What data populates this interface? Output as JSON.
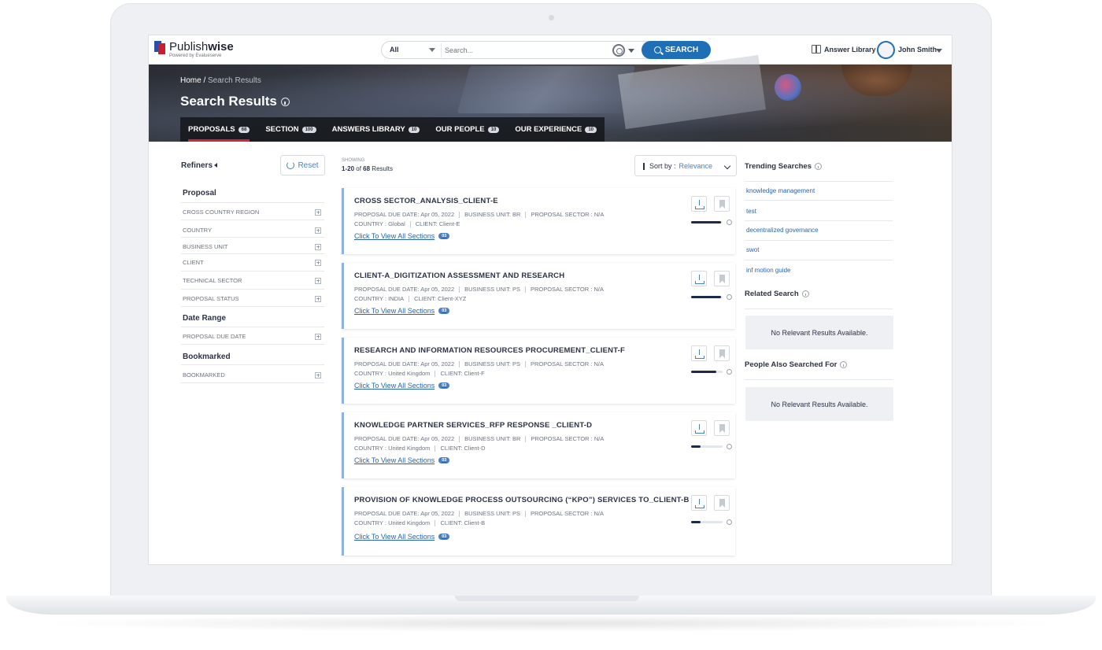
{
  "header": {
    "logo_main": "Publish",
    "logo_bold": "wise",
    "logo_sub": "Powered by Evalueserve",
    "search_scope": "All",
    "search_placeholder": "Search...",
    "search_button": "SEARCH",
    "answer_library": "Answer Library",
    "user_name": "John Smith"
  },
  "banner": {
    "breadcrumb_home": "Home /",
    "breadcrumb_current": "Search Results",
    "title": "Search Results",
    "tabs": [
      {
        "label": "PROPOSALS",
        "count": "68"
      },
      {
        "label": "SECTION",
        "count": "100"
      },
      {
        "label": "ANSWERS LIBRARY",
        "count": "10"
      },
      {
        "label": "OUR PEOPLE",
        "count": "10"
      },
      {
        "label": "OUR EXPERIENCE",
        "count": "10"
      }
    ]
  },
  "refiners": {
    "title": "Refiners",
    "reset": "Reset",
    "sections": [
      {
        "title": "Proposal",
        "items": [
          "CROSS COUNTRY REGION",
          "COUNTRY",
          "BUSINESS UNIT",
          "CLIENT",
          "TECHNICAL SECTOR",
          "PROPOSAL STATUS"
        ]
      },
      {
        "title": "Date Range",
        "items": [
          "PROPOSAL DUE DATE"
        ]
      },
      {
        "title": "Bookmarked",
        "items": [
          "BOOKMARKED"
        ]
      }
    ]
  },
  "results": {
    "showing_label": "SHOWING",
    "range_prefix": "1-20",
    "range_of": "of",
    "range_total": "68",
    "range_suffix": "Results",
    "sort_label": "Sort by :",
    "sort_value": "Relevance",
    "view_link": "Click To View All Sections",
    "items": [
      {
        "title": "CROSS SECTOR_ANALYSIS_CLIENT-E",
        "due": "PROPOSAL DUE DATE: Apr 05, 2022",
        "bu": "BUSINESS UNIT: BR",
        "sector": "PROPOSAL SECTOR : N/A",
        "country": "COUNTRY : Global",
        "client": "CLIENT: Client-E",
        "sections": "03",
        "progress": 0.95
      },
      {
        "title": "CLIENT-A_DIGITIZATION ASSESSMENT AND RESEARCH",
        "due": "PROPOSAL DUE DATE: Apr 05, 2022",
        "bu": "BUSINESS UNIT: PS",
        "sector": "PROPOSAL SECTOR : N/A",
        "country": "COUNTRY : INDIA",
        "client": "CLIENT: Client-XYZ",
        "sections": "03",
        "progress": 0.95
      },
      {
        "title": "RESEARCH AND INFORMATION RESOURCES PROCUREMENT_CLIENT-F",
        "due": "PROPOSAL DUE DATE: Apr 05, 2022",
        "bu": "BUSINESS UNIT: PS",
        "sector": "PROPOSAL SECTOR : N/A",
        "country": "COUNTRY : United Kingdom",
        "client": "CLIENT: Client-F",
        "sections": "03",
        "progress": 0.8
      },
      {
        "title": "KNOWLEDGE PARTNER SERVICES_RFP RESPONSE _CLIENT-D",
        "due": "PROPOSAL DUE DATE: Apr 05, 2022",
        "bu": "BUSINESS UNIT: BR",
        "sector": "PROPOSAL SECTOR : N/A",
        "country": "COUNTRY : United Kingdom",
        "client": "CLIENT: Client-D",
        "sections": "03",
        "progress": 0.3
      },
      {
        "title": "PROVISION OF KNOWLEDGE PROCESS OUTSOURCING (“KPO”) SERVICES TO_CLIENT-B",
        "due": "PROPOSAL DUE DATE: Apr 05, 2022",
        "bu": "BUSINESS UNIT: PS",
        "sector": "PROPOSAL SECTOR : N/A",
        "country": "COUNTRY : United Kingdom",
        "client": "CLIENT: Client-B",
        "sections": "03",
        "progress": 0.3
      }
    ]
  },
  "right": {
    "trending_title": "Trending Searches",
    "trending": [
      "knowledge management",
      "test",
      "decentralized governance",
      "swot",
      "inf motion guide"
    ],
    "related_title": "Related Search",
    "related_empty": "No Relevant Results Available.",
    "people_title": "People Also Searched For",
    "people_empty": "No Relevant Results Available."
  }
}
